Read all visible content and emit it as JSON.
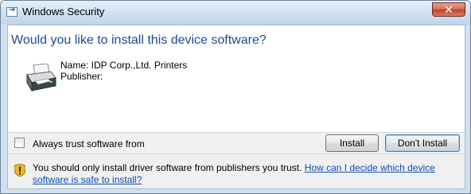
{
  "window": {
    "title": "Windows Security",
    "close_label": "✕"
  },
  "content": {
    "heading": "Would you like to install this device software?",
    "name_line": "Name: IDP Corp.,Ltd. Printers",
    "publisher_line": "Publisher:"
  },
  "options": {
    "always_trust_label": "Always trust software from",
    "always_trust_checked": false,
    "install_label": "Install",
    "dont_install_label": "Don't Install"
  },
  "footer": {
    "warning_text": "You should only install driver software from publishers you trust.",
    "help_link": "How can I decide which device software is safe to install?"
  },
  "icons": {
    "title": "window-security-icon",
    "device": "printer-icon",
    "warning": "shield-warning-icon"
  },
  "colors": {
    "heading": "#1d4a8f",
    "link": "#0d4cb3",
    "frame": "#cfe0f1",
    "close_button": "#c2442d"
  }
}
